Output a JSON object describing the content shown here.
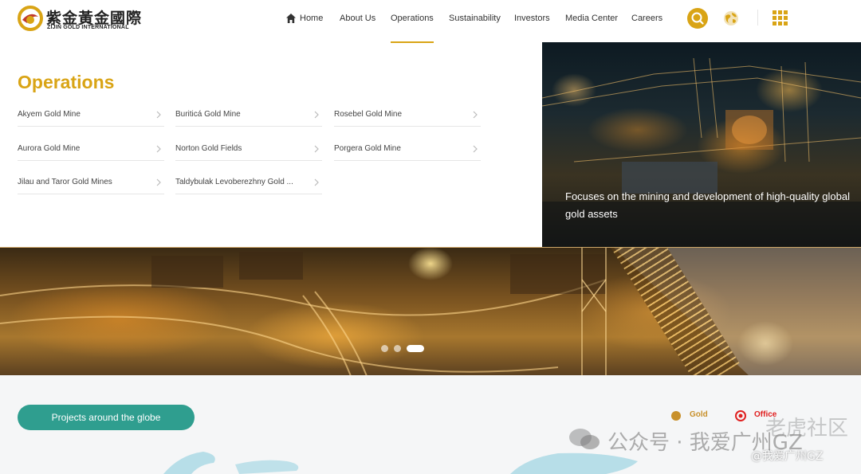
{
  "brand": {
    "name_cn": "紫金黃金國際",
    "name_en": "ZIJIN GOLD INTERNATIONAL",
    "color": "#d9a415"
  },
  "nav": {
    "items": [
      {
        "label": "Home",
        "icon": "home-icon"
      },
      {
        "label": "About Us"
      },
      {
        "label": "Operations",
        "active": true
      },
      {
        "label": "Sustainability"
      },
      {
        "label": "Investors"
      },
      {
        "label": "Media Center"
      },
      {
        "label": "Careers"
      }
    ],
    "actions": [
      "search-icon",
      "globe-language-icon",
      "grid-menu-icon"
    ]
  },
  "operations": {
    "title": "Operations",
    "links": [
      "Akyem Gold Mine",
      "Buriticá Gold Mine",
      "Rosebel Gold Mine",
      "Aurora Gold Mine",
      "Norton Gold Fields",
      "Porgera Gold Mine",
      "Jilau and Taror Gold Mines",
      "Taldybulak Levoberezhny Gold ..."
    ]
  },
  "hero": {
    "caption": "Focuses on the mining and development of high-quality global gold assets"
  },
  "carousel": {
    "slide_count": 3,
    "active_index": 3
  },
  "map": {
    "button_label": "Projects around the globe",
    "legend": [
      {
        "label": "Gold",
        "color": "#c8902a"
      },
      {
        "label": "Office",
        "color": "#e02020"
      }
    ]
  },
  "watermark": {
    "text": "公众号 · 我爱广州GZ",
    "corner": "老虎社区",
    "handle": "@我爱广州GZ"
  }
}
